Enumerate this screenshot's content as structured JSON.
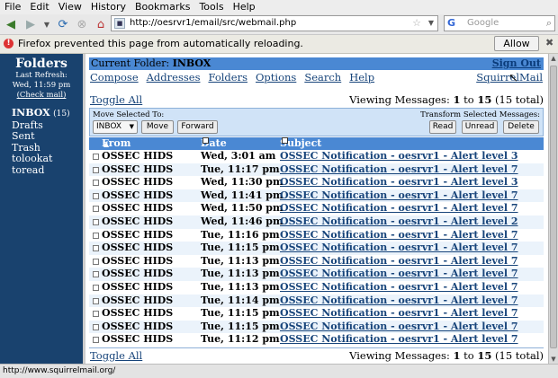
{
  "browser": {
    "menu": [
      "File",
      "Edit",
      "View",
      "History",
      "Bookmarks",
      "Tools",
      "Help"
    ],
    "url": "http://oesrvr1/email/src/webmail.php",
    "search_placeholder": "Google",
    "notification": "Firefox prevented this page from automatically reloading.",
    "allow_label": "Allow",
    "status_text": "http://www.squirrelmail.org/"
  },
  "sidebar": {
    "title": "Folders",
    "last_refresh_label": "Last Refresh:",
    "last_refresh_time": "Wed, 11:59 pm",
    "check_mail": "(Check mail)",
    "folders": [
      {
        "name": "INBOX",
        "count": "(15)"
      },
      {
        "name": "Drafts"
      },
      {
        "name": "Sent"
      },
      {
        "name": "Trash"
      },
      {
        "name": "tolookat"
      },
      {
        "name": "toread"
      }
    ]
  },
  "header": {
    "current_folder_label": "Current Folder:",
    "current_folder": "INBOX",
    "sign_out": "Sign Out",
    "nav": [
      "Compose",
      "Addresses",
      "Folders",
      "Options",
      "Search",
      "Help"
    ],
    "brand_link": "SquirrelMail"
  },
  "list": {
    "toggle_all": "Toggle All",
    "viewing_prefix": "Viewing Messages:",
    "range_start": "1",
    "range_to": "to",
    "range_end": "15",
    "total": "(15 total)",
    "move_selected_label": "Move Selected To:",
    "transform_label": "Transform Selected Messages:",
    "move_target": "INBOX",
    "buttons": {
      "move": "Move",
      "forward": "Forward",
      "read": "Read",
      "unread": "Unread",
      "delete": "Delete"
    },
    "columns": {
      "from": "From",
      "date": "Date",
      "subject": "Subject"
    },
    "messages": [
      {
        "from": "OSSEC HIDS",
        "date": "Wed, 3:01 am",
        "subject": "OSSEC Notification - oesrvr1 - Alert level 3"
      },
      {
        "from": "OSSEC HIDS",
        "date": "Tue, 11:17 pm",
        "subject": "OSSEC Notification - oesrvr1 - Alert level 7"
      },
      {
        "from": "OSSEC HIDS",
        "date": "Wed, 11:30 pm",
        "subject": "OSSEC Notification - oesrvr1 - Alert level 3"
      },
      {
        "from": "OSSEC HIDS",
        "date": "Wed, 11:41 pm",
        "subject": "OSSEC Notification - oesrvr1 - Alert level 7"
      },
      {
        "from": "OSSEC HIDS",
        "date": "Wed, 11:50 pm",
        "subject": "OSSEC Notification - oesrvr1 - Alert level 7"
      },
      {
        "from": "OSSEC HIDS",
        "date": "Wed, 11:46 pm",
        "subject": "OSSEC Notification - oesrvr1 - Alert level 2"
      },
      {
        "from": "OSSEC HIDS",
        "date": "Tue, 11:16 pm",
        "subject": "OSSEC Notification - oesrvr1 - Alert level 7"
      },
      {
        "from": "OSSEC HIDS",
        "date": "Tue, 11:15 pm",
        "subject": "OSSEC Notification - oesrvr1 - Alert level 7"
      },
      {
        "from": "OSSEC HIDS",
        "date": "Tue, 11:13 pm",
        "subject": "OSSEC Notification - oesrvr1 - Alert level 7"
      },
      {
        "from": "OSSEC HIDS",
        "date": "Tue, 11:13 pm",
        "subject": "OSSEC Notification - oesrvr1 - Alert level 7"
      },
      {
        "from": "OSSEC HIDS",
        "date": "Tue, 11:13 pm",
        "subject": "OSSEC Notification - oesrvr1 - Alert level 7"
      },
      {
        "from": "OSSEC HIDS",
        "date": "Tue, 11:14 pm",
        "subject": "OSSEC Notification - oesrvr1 - Alert level 7"
      },
      {
        "from": "OSSEC HIDS",
        "date": "Tue, 11:15 pm",
        "subject": "OSSEC Notification - oesrvr1 - Alert level 7"
      },
      {
        "from": "OSSEC HIDS",
        "date": "Tue, 11:15 pm",
        "subject": "OSSEC Notification - oesrvr1 - Alert level 7"
      },
      {
        "from": "OSSEC HIDS",
        "date": "Tue, 11:12 pm",
        "subject": "OSSEC Notification - oesrvr1 - Alert level 7"
      }
    ]
  }
}
